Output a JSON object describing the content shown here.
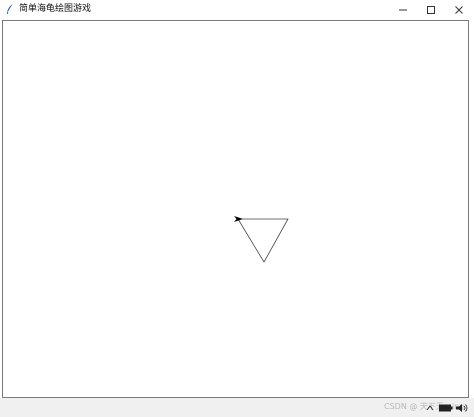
{
  "window": {
    "title": "简单海龟绘图游戏",
    "controls": {
      "minimize_icon": "minimize-icon",
      "maximize_icon": "maximize-icon",
      "close_icon": "close-icon"
    }
  },
  "canvas": {
    "shape": "triangle",
    "stroke_color": "#444444",
    "turtle_icon": "turtle-arrow-icon"
  },
  "overlay": {
    "watermark": "CSDN @ 天下无…ing"
  },
  "tray": {
    "icons": [
      "chevron-up-icon",
      "battery-icon",
      "volume-icon"
    ]
  }
}
